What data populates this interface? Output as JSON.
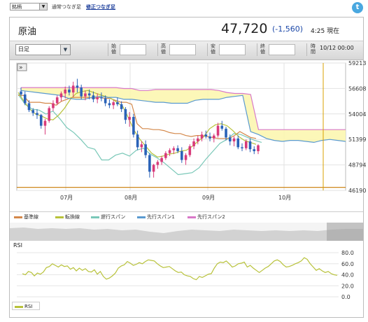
{
  "topbar": {
    "select_value": "銘柄",
    "link_normal": "通常つなぎ足",
    "link_adjusted": "修正つなぎ足",
    "twitter_glyph": "t"
  },
  "header": {
    "title": "原油",
    "price": "47,720",
    "change": "(-1,560)",
    "time_label": "4:25 現在"
  },
  "controls": {
    "period_value": "日足",
    "fields": [
      {
        "label": "始値",
        "value": ""
      },
      {
        "label": "高値",
        "value": ""
      },
      {
        "label": "安値",
        "value": ""
      },
      {
        "label": "終値",
        "value": ""
      }
    ],
    "time_field_label": "時間",
    "datetime": "10/12 00:00"
  },
  "legend": {
    "items": [
      {
        "label": "基準線",
        "color": "#d4884a"
      },
      {
        "label": "転換線",
        "color": "#b8c23a"
      },
      {
        "label": "遅行スパン",
        "color": "#7ac8b8"
      },
      {
        "label": "先行スパン1",
        "color": "#5a9ad0"
      },
      {
        "label": "先行スパン2",
        "color": "#d878c8"
      }
    ],
    "rsi_item": {
      "label": "RSI",
      "color": "#b8c23a"
    }
  },
  "rsi_title": "RSI",
  "colors": {
    "up_candle": "#d83a7a",
    "down_candle": "#2a62b8",
    "cloud": "#fcf6b0",
    "cursor_line": "#d8a000",
    "support_line": "#c87a00"
  },
  "chart_data": [
    {
      "type": "candlestick",
      "x_ticks": [
        "07月",
        "08月",
        "09月",
        "10月"
      ],
      "y_ticks": [
        59213.5,
        56608.8,
        54004.1,
        51399.4,
        48794.7,
        46190.0
      ],
      "ylim": [
        46190.0,
        59213.5
      ],
      "grid": true,
      "series": [
        {
          "name": "基準線",
          "values": [
            55900,
            55900,
            55200,
            55200,
            55200,
            55100,
            55100,
            54900,
            55300,
            55500,
            55700,
            55700,
            55700,
            55700,
            55600,
            55700,
            55600,
            55600,
            55400,
            55200,
            55200,
            55000,
            53000,
            52500,
            52500,
            52400,
            52400,
            52300,
            52100,
            52000,
            52000,
            51800,
            51700,
            51800,
            51800,
            51700,
            51600,
            51500,
            51500,
            51500,
            51800,
            52200,
            51900,
            51600,
            51500
          ]
        },
        {
          "name": "転換線",
          "values": [
            56200,
            55300,
            54500,
            54000,
            53800,
            53500,
            53400,
            53900,
            54600,
            55500,
            56100,
            56300,
            56400,
            56200,
            56000,
            55800,
            55600,
            55200,
            54800,
            53600,
            52300,
            51400,
            50700,
            50000,
            49600,
            49700,
            49900,
            50000,
            50200,
            50300,
            50700,
            51200,
            51700,
            52500,
            52900,
            53000,
            52800,
            52300,
            51700,
            51300,
            51100,
            50900
          ]
        },
        {
          "name": "遅行スパン",
          "values": [
            56000,
            55000,
            54500,
            54400,
            54000,
            54300,
            53500,
            52600,
            52100,
            51400,
            50600,
            50400,
            49300,
            49300,
            49800,
            50000,
            49700,
            50300,
            50500,
            49900,
            49500,
            49000,
            48400,
            47800,
            47900,
            48000,
            48500,
            49400,
            50200,
            51000,
            51400,
            52000,
            51900,
            51600,
            51300,
            51100
          ]
        },
        {
          "name": "先行スパン1",
          "values": [
            56400,
            56300,
            56200,
            56100,
            56000,
            55900,
            55600,
            55500,
            55500,
            55700,
            55800,
            55700,
            55700,
            55500,
            55500,
            55400,
            55300,
            55200,
            55200,
            55100,
            55100,
            55100,
            55400,
            55500,
            55500,
            55500,
            55700,
            55800,
            55900,
            52200,
            51900,
            51500,
            51300,
            51200,
            51300,
            51300,
            51200,
            51100,
            51300,
            51400,
            51300,
            51200
          ]
        },
        {
          "name": "先行スパン2",
          "values": [
            56700,
            56700,
            56700,
            56700,
            56700,
            56700,
            56700,
            56700,
            56700,
            56700,
            56700,
            56700,
            56700,
            56600,
            56600,
            56400,
            56400,
            56500,
            56500,
            56500,
            56500,
            56500,
            56500,
            56500,
            56500,
            56400,
            56200,
            56100,
            56100,
            56000,
            52400,
            52400,
            52400,
            52400,
            52400,
            52400,
            52400,
            52400,
            52400,
            52400,
            52400,
            52400
          ]
        }
      ],
      "candles": [
        [
          56300,
          56700,
          55800,
          56000
        ],
        [
          56000,
          56300,
          54900,
          55100
        ],
        [
          55100,
          55400,
          54200,
          54400
        ],
        [
          54400,
          54600,
          53800,
          54100
        ],
        [
          54100,
          54500,
          53500,
          53900
        ],
        [
          53900,
          54000,
          52500,
          52800
        ],
        [
          52800,
          53500,
          51900,
          53300
        ],
        [
          53300,
          54800,
          53100,
          54600
        ],
        [
          54600,
          55400,
          54300,
          55100
        ],
        [
          55100,
          55900,
          54900,
          55700
        ],
        [
          55700,
          56300,
          55300,
          56100
        ],
        [
          56100,
          56800,
          55600,
          56500
        ],
        [
          56500,
          56900,
          55900,
          56200
        ],
        [
          56200,
          57300,
          55700,
          56900
        ],
        [
          56900,
          57600,
          56200,
          56700
        ],
        [
          56700,
          57000,
          55500,
          55800
        ],
        [
          55800,
          56400,
          55400,
          56100
        ],
        [
          56100,
          56500,
          55500,
          55900
        ],
        [
          55900,
          56300,
          55200,
          55500
        ],
        [
          55500,
          56100,
          55100,
          55700
        ],
        [
          55700,
          56200,
          55300,
          55600
        ],
        [
          55600,
          55900,
          54800,
          55100
        ],
        [
          55100,
          55500,
          54600,
          54900
        ],
        [
          54900,
          55400,
          54500,
          55200
        ],
        [
          55200,
          55700,
          54800,
          55000
        ],
        [
          55000,
          55300,
          54200,
          54500
        ],
        [
          54500,
          54700,
          53000,
          53400
        ],
        [
          53400,
          54200,
          52700,
          53700
        ],
        [
          53700,
          54000,
          51600,
          51900
        ],
        [
          51900,
          52300,
          50300,
          50600
        ],
        [
          50600,
          51200,
          50100,
          50900
        ],
        [
          50900,
          51300,
          49500,
          49800
        ],
        [
          49800,
          50000,
          47500,
          48100
        ],
        [
          48100,
          48900,
          47500,
          48800
        ],
        [
          48800,
          49300,
          48400,
          49100
        ],
        [
          49100,
          49700,
          48800,
          49500
        ],
        [
          49500,
          50200,
          49300,
          50000
        ],
        [
          50000,
          50500,
          49700,
          50300
        ],
        [
          50300,
          50700,
          49900,
          50500
        ],
        [
          50500,
          50800,
          50000,
          50200
        ],
        [
          50200,
          50600,
          49000,
          49300
        ],
        [
          49300,
          50000,
          48800,
          49800
        ],
        [
          49800,
          50900,
          49600,
          50700
        ],
        [
          50700,
          51500,
          50400,
          51200
        ],
        [
          51200,
          51800,
          50900,
          51500
        ],
        [
          51500,
          52200,
          51200,
          51900
        ],
        [
          51900,
          52300,
          51500,
          51700
        ],
        [
          51700,
          52100,
          51200,
          51500
        ],
        [
          51500,
          52000,
          51100,
          51800
        ],
        [
          51800,
          53100,
          51600,
          52800
        ],
        [
          52800,
          53300,
          52300,
          52500
        ],
        [
          52500,
          52700,
          51300,
          51600
        ],
        [
          51600,
          51900,
          50800,
          51200
        ],
        [
          51200,
          51700,
          50700,
          51500
        ],
        [
          51500,
          51800,
          50400,
          50600
        ],
        [
          50600,
          51000,
          50200,
          50500
        ],
        [
          50500,
          51400,
          50300,
          51200
        ],
        [
          51200,
          51500,
          50100,
          50400
        ],
        [
          50400,
          50700,
          49900,
          50200
        ],
        [
          50200,
          50900,
          49900,
          50800
        ]
      ]
    },
    {
      "type": "line",
      "title": "RSI",
      "y_ticks": [
        80.0,
        60.0,
        40.0,
        20.0,
        0.0
      ],
      "ylim": [
        0,
        80
      ],
      "grid": true,
      "series": [
        {
          "name": "RSI",
          "values": [
            42,
            40,
            46,
            44,
            38,
            43,
            41,
            45,
            53,
            55,
            60,
            57,
            54,
            58,
            55,
            56,
            50,
            53,
            47,
            52,
            48,
            51,
            46,
            45,
            49,
            41,
            46,
            37,
            32,
            34,
            38,
            43,
            52,
            56,
            58,
            64,
            61,
            57,
            59,
            62,
            60,
            64,
            67,
            66,
            65,
            60,
            56,
            53,
            54,
            55,
            51,
            47,
            44,
            45,
            40,
            38,
            37,
            33,
            31,
            37,
            35,
            38,
            41,
            42,
            52,
            60,
            63,
            62,
            65,
            60,
            54,
            56,
            60,
            61,
            63,
            54,
            57,
            52,
            48,
            44,
            48,
            52,
            55,
            60,
            65,
            67,
            64,
            58,
            54,
            55,
            57,
            60,
            62,
            65,
            71,
            68,
            60,
            54,
            48,
            51,
            47,
            44,
            46,
            42,
            40,
            39
          ]
        }
      ]
    }
  ]
}
